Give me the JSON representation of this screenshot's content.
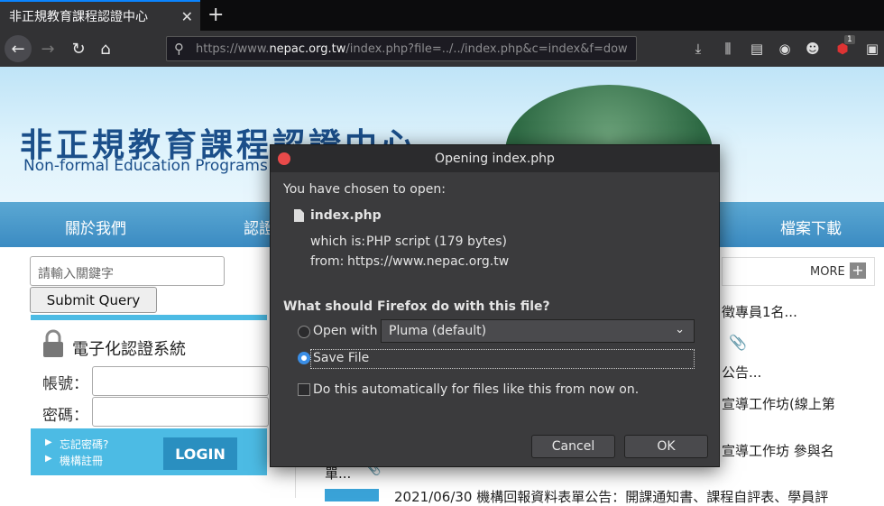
{
  "browser": {
    "tab_title": "非正規教育課程認證中心",
    "url_prefix": "https://www.",
    "url_host": "nepac.org.tw",
    "url_path": "/index.php?file=../../index.php&c=index&f=dow",
    "badge_count": "1"
  },
  "site": {
    "title_zh": "非正規教育課程認證中心",
    "title_en": "Non-formal Education Programs Ac",
    "menu": [
      "關於我們",
      "認證",
      "檔案下載"
    ],
    "search_placeholder": "請輸入關鍵字",
    "submit_label": "Submit Query",
    "login": {
      "title": "電子化認證系統",
      "account_label": "帳號：",
      "password_label": "密碼：",
      "forgot_link": "忘記密碼?",
      "register_link": "機構註冊",
      "login_button": "LOGIN"
    },
    "more_label": "MORE",
    "news": [
      "徵專員1名...",
      "公告...",
      "宣導工作坊(線上第",
      "宣導工作坊 參與名",
      "單...",
      "2021/06/30    機構回報資料表單公告：開課通知書、課程自評表、學員評"
    ]
  },
  "dialog": {
    "title": "Opening index.php",
    "chosen_label": "You have chosen to open:",
    "filename": "index.php",
    "which_is_label": "which is:",
    "which_is_value": "PHP script (179 bytes)",
    "from_label": "from:",
    "from_value": "https://www.nepac.org.tw",
    "question": "What should Firefox do with this file?",
    "open_with_label": "Open with",
    "open_with_app": "Pluma (default)",
    "save_file_label": "Save File",
    "auto_label": "Do this automatically for files like this from now on.",
    "cancel_label": "Cancel",
    "ok_label": "OK"
  }
}
